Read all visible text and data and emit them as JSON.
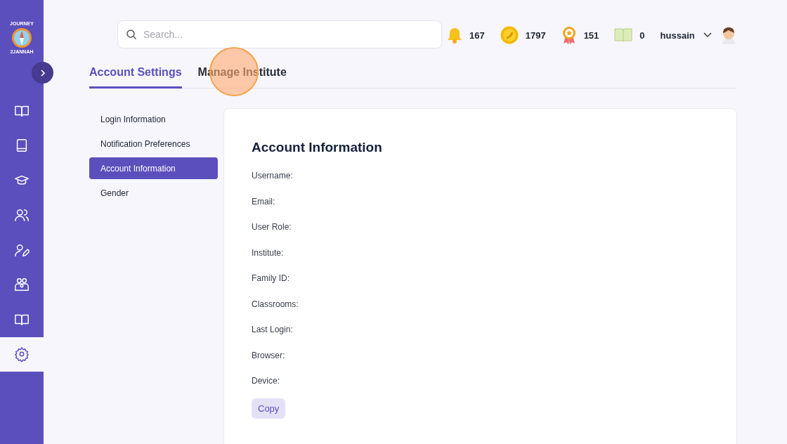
{
  "logo": {
    "top": "JOURNEY",
    "bottom": "2JANNAH"
  },
  "sidebar": {
    "items": [
      {
        "selected": false
      },
      {
        "selected": false
      },
      {
        "selected": false
      },
      {
        "selected": false
      },
      {
        "selected": false
      },
      {
        "selected": false
      },
      {
        "selected": false
      },
      {
        "selected": true
      }
    ]
  },
  "search": {
    "placeholder": "Search..."
  },
  "stats": [
    {
      "kind": "bell",
      "value": "167"
    },
    {
      "kind": "coin",
      "value": "1797"
    },
    {
      "kind": "medal",
      "value": "151"
    },
    {
      "kind": "book",
      "value": "0"
    }
  ],
  "user": {
    "name": "hussain"
  },
  "tabs": [
    {
      "label": "Account Settings",
      "selected": true
    },
    {
      "label": "Manage Institute",
      "selected": false
    }
  ],
  "menu": [
    {
      "label": "Login Information",
      "selected": false
    },
    {
      "label": "Notification Preferences",
      "selected": false
    },
    {
      "label": "Account Information",
      "selected": true
    },
    {
      "label": "Gender",
      "selected": false
    }
  ],
  "panel": {
    "title": "Account Information",
    "fields": [
      "Username:",
      "Email:",
      "User Role:",
      "Institute:",
      "Family ID:",
      "Classrooms:",
      "Last Login:",
      "Browser:",
      "Device:"
    ],
    "button": "Copy"
  }
}
